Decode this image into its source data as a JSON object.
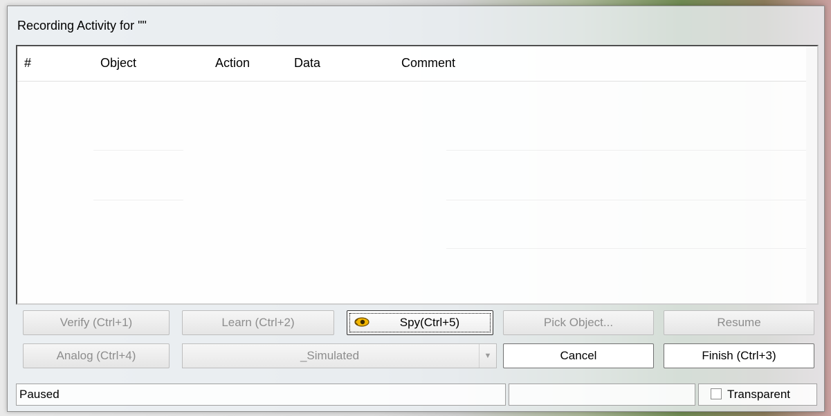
{
  "window": {
    "title": "Recording Activity for \"\""
  },
  "grid": {
    "columns": [
      "#",
      "Object",
      "Action",
      "Data",
      "Comment"
    ],
    "rows": []
  },
  "buttons": {
    "verify": "Verify (Ctrl+1)",
    "learn": "Learn (Ctrl+2)",
    "spy": "Spy(Ctrl+5)",
    "pick_object": "Pick Object...",
    "resume": "Resume",
    "analog": "Analog (Ctrl+4)",
    "cancel": "Cancel",
    "finish": "Finish (Ctrl+3)"
  },
  "mode_select": {
    "value": "_Simulated",
    "arrow_icon": "chevron-down-icon"
  },
  "status": {
    "text": "Paused",
    "middle": "",
    "transparent_label": "Transparent",
    "transparent_checked": false
  },
  "colors": {
    "disabled_text": "#8d8d8d",
    "spy_icon": "#e0a800"
  }
}
